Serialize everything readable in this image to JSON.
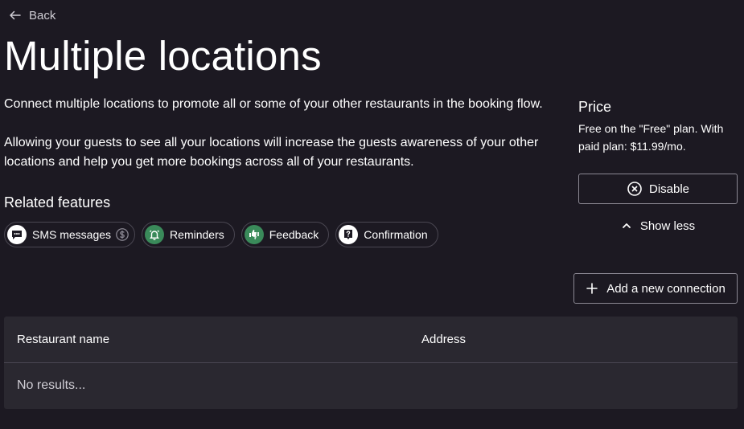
{
  "nav": {
    "back_label": "Back"
  },
  "page": {
    "title": "Multiple locations",
    "description_1": "Connect multiple locations to promote all or some of your other restaurants in the booking flow.",
    "description_2": "Allowing your guests to see all your locations will increase the guests awareness of your other locations and help you get more bookings across all of your restaurants."
  },
  "related": {
    "title": "Related features",
    "chips": [
      {
        "label": "SMS messages",
        "icon": "message-icon",
        "has_dollar": true
      },
      {
        "label": "Reminders",
        "icon": "alarm-icon"
      },
      {
        "label": "Feedback",
        "icon": "thumbs-icon"
      },
      {
        "label": "Confirmation",
        "icon": "question-icon"
      }
    ]
  },
  "pricing": {
    "title": "Price",
    "text": "Free on the \"Free\" plan. With paid plan: $11.99/mo."
  },
  "actions": {
    "disable_label": "Disable",
    "show_less_label": "Show less",
    "add_connection_label": "Add a new connection"
  },
  "table": {
    "columns": [
      "Restaurant name",
      "Address"
    ],
    "empty_text": "No results..."
  },
  "colors": {
    "background": "#1c1922",
    "panel": "#2a2830",
    "border": "#8b8893",
    "chip_green": "#3a8a5a"
  }
}
